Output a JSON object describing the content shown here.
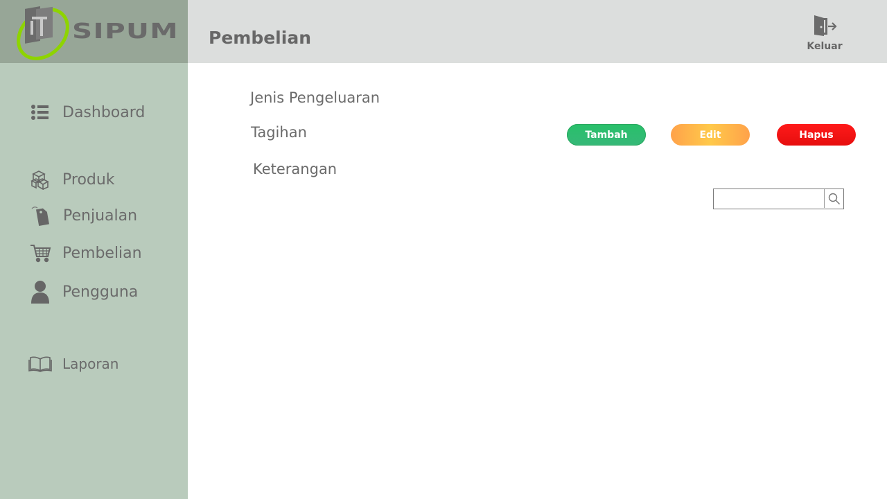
{
  "app": {
    "logo_text": "SIPUM"
  },
  "header": {
    "title": "Pembelian",
    "logout_label": "Keluar"
  },
  "sidebar": {
    "items": [
      {
        "label": "Dashboard",
        "icon": "list-icon"
      },
      {
        "label": "Produk",
        "icon": "boxes-icon"
      },
      {
        "label": "Penjualan",
        "icon": "tag-icon"
      },
      {
        "label": "Pembelian",
        "icon": "cart-icon"
      },
      {
        "label": "Pengguna",
        "icon": "user-icon"
      },
      {
        "label": "Laporan",
        "icon": "book-icon"
      }
    ]
  },
  "main": {
    "menu": [
      "Jenis Pengeluaran",
      "Tagihan",
      "Keterangan"
    ],
    "buttons": {
      "add": "Tambah",
      "edit": "Edit",
      "delete": "Hapus"
    },
    "search": {
      "value": "",
      "icon": "search-icon"
    }
  },
  "colors": {
    "sidebar_bg": "#b9cbbc",
    "logo_bg": "#97a697",
    "header_bg": "#dcdedd",
    "add": "#2dbd6e",
    "edit": "#ffb347",
    "delete": "#f21212"
  }
}
